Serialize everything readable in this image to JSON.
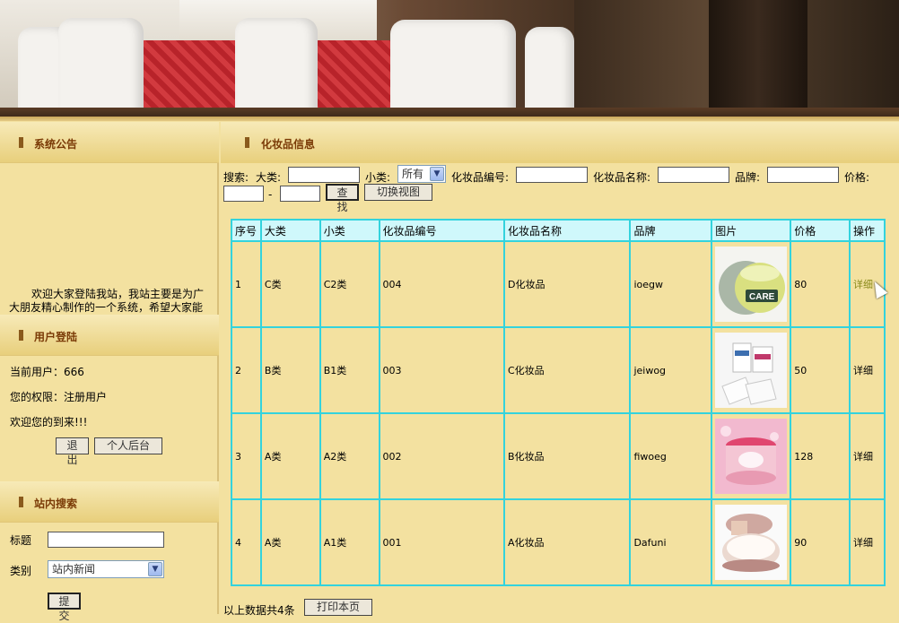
{
  "notice": {
    "title": "系统公告",
    "text": "欢迎大家登陆我站，我站主要是为广大朋友精心制作的一个系统，希望大家能"
  },
  "login": {
    "title": "用户登陆",
    "current_user_label": "当前用户：",
    "current_user": "666",
    "role_label": "您的权限：",
    "role": "注册用户",
    "welcome": "欢迎您的到来!!!",
    "logout_label": "退出",
    "backend_label": "个人后台"
  },
  "site_search": {
    "title": "站内搜索",
    "title_field_label": "标题",
    "category_label": "类别",
    "category_selected": "站内新闻",
    "submit_label": "提交"
  },
  "main": {
    "title": "化妆品信息",
    "search": {
      "prefix": "搜索:",
      "major_label": "大类:",
      "minor_label": "小类:",
      "minor_selected": "所有",
      "code_label": "化妆品编号:",
      "name_label": "化妆品名称:",
      "brand_label": "品牌:",
      "price_label": "价格:",
      "price_sep": "-",
      "find_label": "查找",
      "switch_label": "切换视图"
    },
    "table": {
      "headers": [
        "序号",
        "大类",
        "小类",
        "化妆品编号",
        "化妆品名称",
        "品牌",
        "图片",
        "价格",
        "操作"
      ],
      "rows": [
        {
          "no": "1",
          "major": "C类",
          "minor": "C2类",
          "code": "004",
          "name": "D化妆品",
          "brand": "ioegw",
          "image": "cream-jar-green",
          "price": "80",
          "action": "详细"
        },
        {
          "no": "2",
          "major": "B类",
          "minor": "B1类",
          "code": "003",
          "name": "C化妆品",
          "brand": "jeiwog",
          "image": "sachet-pack",
          "price": "50",
          "action": "详细"
        },
        {
          "no": "3",
          "major": "A类",
          "minor": "A2类",
          "code": "002",
          "name": "B化妆品",
          "brand": "fiwoeg",
          "image": "cream-jar-pink",
          "price": "128",
          "action": "详细"
        },
        {
          "no": "4",
          "major": "A类",
          "minor": "A1类",
          "code": "001",
          "name": "A化妆品",
          "brand": "Dafuni",
          "image": "powder-compact",
          "price": "90",
          "action": "详细"
        }
      ]
    },
    "footer": {
      "count_text": "以上数据共4条",
      "print_label": "打印本页"
    }
  }
}
